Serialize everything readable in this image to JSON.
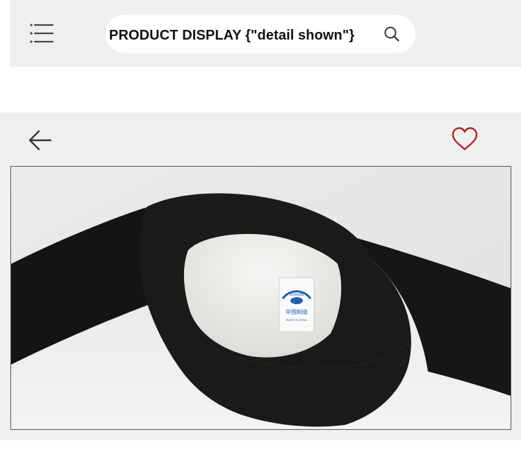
{
  "header": {
    "search_text": "PRODUCT DISPLAY {\"detail shown\"}",
    "menu_icon": "hamburger-menu-icon",
    "search_icon": "search-icon"
  },
  "product_panel": {
    "back_icon": "back-arrow-icon",
    "favorite_icon": "heart-icon",
    "image": {
      "subject": "raglan sweatshirt collar close-up",
      "label_text_top": "SIYAYAN",
      "label_text_bottom": "MADE IN CHINA",
      "label_text_chinese": "中国制造"
    }
  },
  "colors": {
    "top_bar_bg": "#efefef",
    "panel_bg": "#efefef",
    "heart": "#b0262d",
    "label_blue": "#1f5fae"
  }
}
